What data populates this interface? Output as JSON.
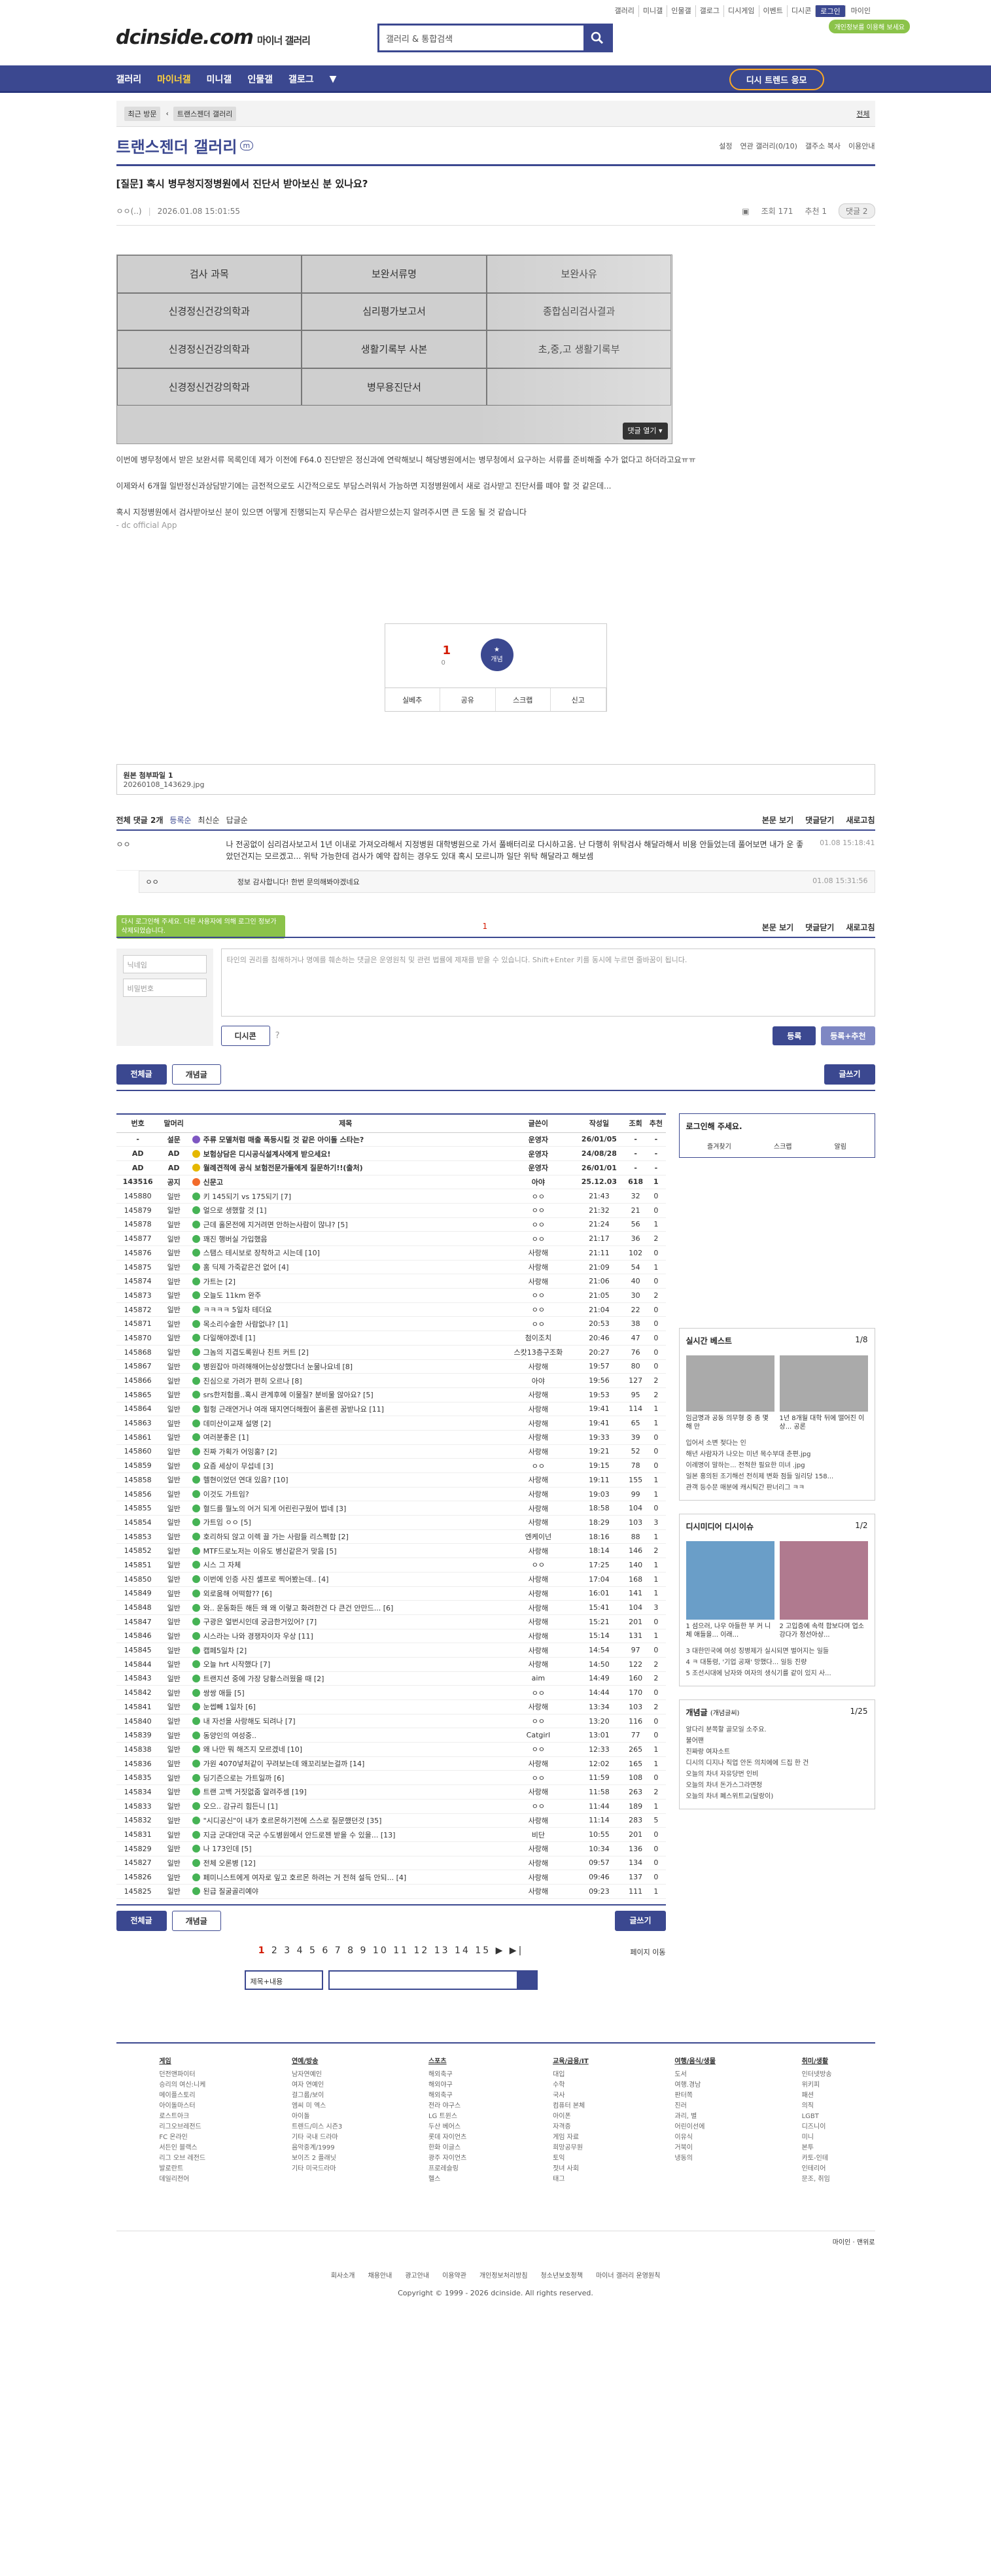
{
  "top": {
    "links": [
      "갤러리",
      "미니갤",
      "인물갤",
      "갤로그",
      "디시게임",
      "이벤트",
      "디시콘",
      "로그인"
    ],
    "mycontent": "마이인",
    "notice": "개인정보를 이용해 보세요"
  },
  "logo": {
    "main": "dcinside.com",
    "sub": "마이너 갤러리"
  },
  "search": {
    "placeholder": "갤러리 & 통합검색"
  },
  "gnb": {
    "items": [
      "갤러리",
      "마이너갤",
      "미니갤",
      "인물갤",
      "갤로그"
    ],
    "write": "디시 트렌드 응모"
  },
  "crumb": {
    "recent": "최근 방문",
    "item": "트랜스젠더 갤러리",
    "right": "전체"
  },
  "gallery": {
    "title": "트랜스젠더 갤러리",
    "opts": [
      "설정",
      "연관 갤러리(0/10)",
      "갤주소 복사",
      "이용안내"
    ]
  },
  "post": {
    "title": "[질문] 혹시 병무청지정병원에서 진단서 받아보신 분 있나요?",
    "author": "ㅇㅇ(..)",
    "date": "2026.01.08 15:01:55",
    "views": "조회 171",
    "recommend": "추천 1",
    "comments": "댓글 2",
    "image_cells": [
      "검사 과목",
      "보완서류명",
      "보완사유",
      "신경정신건강의학과",
      "심리평가보고서",
      "종합심리검사결과",
      "신경정신건강의학과",
      "생활기록부 사본",
      "초,중,고 생활기록부",
      "신경정신건강의학과",
      "병무용진단서",
      ""
    ],
    "image_more": "댓글 열기 ▾",
    "body": [
      "이번에 병무청에서 받은 보완서류 목록인데 제가 이전에 F64.0 진단받은 정신과에 연락해보니 해당병원에서는 병무청에서 요구하는 서류를 준비해줄 수가 없다고 하더라고요ㅠㅠ",
      "이제와서 6개월 일반정신과상담받기에는 금전적으로도 시간적으로도 부담스러워서 가능하면 지정병원에서 새로 검사받고 진단서를 떼야 할 것 같은데...",
      "혹시 지정병원에서 검사받아보신 분이 있으면 어떻게 진행되는지 무슨무슨 검사받으셨는지 알려주시면 큰 도움 될 것 같습니다",
      "- dc official App"
    ]
  },
  "recom": {
    "count": "1",
    "sub": "0",
    "circle": "개념",
    "actions": [
      "실베추",
      "공유",
      "스크랩",
      "신고"
    ]
  },
  "file": {
    "label": "원본 첨부파일 1",
    "name": "20260108_143629.jpg"
  },
  "cmt": {
    "head": "전체 댓글 2개",
    "sort": [
      "등록순",
      "최신순",
      "답글순"
    ],
    "right": [
      "본문 보기",
      "댓글닫기",
      "새로고침"
    ],
    "items": [
      {
        "nick": "ㅇㅇ",
        "text": "나 전공없이 심리검사보고서 1년 이내로 가져오라해서 지정병원 대학병원으로 가서 풀배터리로 다시하고옴. 난 다행히 위탁검사 해달라해서 비용 안들었는데 풀어보면 내가 운 좋았던건지는 모르겠고... 위탁 가능한데 검사가 예약 잡히는 경우도 있대 혹시 모르니까 일단 위탁 해달라고 해보셈",
        "date": "01.08 15:18:41"
      }
    ],
    "reply": {
      "nick": "ㅇㅇ",
      "text": "정보 감사합니다! 한번 문의해봐야겠네요",
      "date": "01.08 15:31:56"
    }
  },
  "write": {
    "page": "1",
    "tip": "다시 로그인해 주세요. 다른 사용자에 의해 로그인 정보가 삭제되었습니다.",
    "nick": "닉네임",
    "pw": "비밀번호",
    "placeholder": "타인의 권리를 침해하거나 명예를 훼손하는 댓글은 운영원칙 및 관련 법률에 제재를 받을 수 있습니다. Shift+Enter 키를 동시에 누르면 줄바꿈이 됩니다.",
    "dccon": "디시콘",
    "submit": "등록",
    "submit2": "등록+추천"
  },
  "tabs": {
    "all": "전체글",
    "concept": "개념글",
    "write": "글쓰기"
  },
  "table": {
    "headers": [
      "번호",
      "말머리",
      "제목",
      "글쓴이",
      "작성일",
      "조회",
      "추천"
    ],
    "rows": [
      [
        "-",
        "설문",
        "주류 모델처럼 매출 폭등시킬 것 같은 아이돌 스타는?",
        "운영자",
        "26/01/05",
        "-",
        "-"
      ],
      [
        "AD",
        "AD",
        "보험상담은 디시공식설계사에게 받으세요!",
        "운영자",
        "24/08/28",
        "-",
        "-"
      ],
      [
        "AD",
        "AD",
        "월례견적에 공식 보험전문가들에게 질문하기!!(출처)",
        "운영자",
        "26/01/01",
        "-",
        "-"
      ],
      [
        "143516",
        "공지",
        "신문고",
        "아야",
        "25.12.03",
        "618",
        "1"
      ],
      [
        "145880",
        "일반",
        "키 145되기 vs 175되기 [7]",
        "ㅇㅇ",
        "21:43",
        "32",
        "0"
      ],
      [
        "145879",
        "일반",
        "얼으로 생했할 것 [1]",
        "ㅇㅇ",
        "21:32",
        "21",
        "0"
      ],
      [
        "145878",
        "일반",
        "근데 홀몬전에 지거려면 안하는사람이 많냐? [5]",
        "ㅇㅇ",
        "21:24",
        "56",
        "1"
      ],
      [
        "145877",
        "일반",
        "꽤진 행버실 가입했음",
        "ㅇㅇ",
        "21:17",
        "36",
        "2"
      ],
      [
        "145876",
        "일반",
        "스탬스 테시보로 장착하고 시는데 [10]",
        "사랑해",
        "21:11",
        "102",
        "0"
      ],
      [
        "145875",
        "일반",
        "홈 딕제 가죽같은건 없어 [4]",
        "사랑해",
        "21:09",
        "54",
        "1"
      ],
      [
        "145874",
        "일반",
        "가트는 [2]",
        "사랑해",
        "21:06",
        "40",
        "0"
      ],
      [
        "145873",
        "일반",
        "오늘도 11km 완주",
        "ㅇㅇ",
        "21:05",
        "30",
        "2"
      ],
      [
        "145872",
        "일반",
        "ㅋㅋㅋㅋ 5일차 테더요",
        "ㅇㅇ",
        "21:04",
        "22",
        "0"
      ],
      [
        "145871",
        "일반",
        "목소리수술한 사람없냐? [1]",
        "ㅇㅇ",
        "20:53",
        "38",
        "0"
      ],
      [
        "145870",
        "일반",
        "다일해야겠네 [1]",
        "첨이조치",
        "20:46",
        "47",
        "0"
      ],
      [
        "145868",
        "일반",
        "그놈의 지겹도록원나 친트 커트 [2]",
        "스캇13층구조화",
        "20:27",
        "76",
        "0"
      ],
      [
        "145867",
        "일반",
        "병원잡아 마려해해어는상상했다너 눈물나요네 [8]",
        "사랑해",
        "19:57",
        "80",
        "0"
      ],
      [
        "145866",
        "일반",
        "진심으로 가려가 편히 오르나 [8]",
        "아야",
        "19:56",
        "127",
        "2"
      ],
      [
        "145865",
        "일반",
        "srs한저험를..혹시 관계후에 이물질? 분비물 않아요? [5]",
        "사랑해",
        "19:53",
        "95",
        "2"
      ],
      [
        "145864",
        "일반",
        "헐헝 근래연거나 여래 돼지연더해줬어 홀론렌 꿈받나요 [11]",
        "사랑해",
        "19:41",
        "114",
        "1"
      ],
      [
        "145863",
        "일반",
        "데미산이교재 설명 [2]",
        "사랑해",
        "19:41",
        "65",
        "1"
      ],
      [
        "145861",
        "일반",
        "여러분좋은 [1]",
        "사랑해",
        "19:33",
        "39",
        "0"
      ],
      [
        "145860",
        "일반",
        "진짜 가획가 어잉홍? [2]",
        "사랑해",
        "19:21",
        "52",
        "0"
      ],
      [
        "145859",
        "일반",
        "요즘 세상이 무섭네 [3]",
        "ㅇㅇ",
        "19:15",
        "78",
        "0"
      ],
      [
        "145858",
        "일반",
        "헬현이었던 연대 있음? [10]",
        "사랑해",
        "19:11",
        "155",
        "1"
      ],
      [
        "145856",
        "일반",
        "이것도 가트임?",
        "사랑해",
        "19:03",
        "99",
        "1"
      ],
      [
        "145855",
        "일반",
        "혈드를 뭘노의 어거 되게 어린린구웠어 법네 [3]",
        "사랑해",
        "18:58",
        "104",
        "0"
      ],
      [
        "145854",
        "일반",
        "가트임 ㅇㅇ [5]",
        "사랑해",
        "18:29",
        "103",
        "3"
      ],
      [
        "145853",
        "일반",
        "호리하되 않고 이렉 끌 가는 사람들 리스펙함 [2]",
        "엔케이넌",
        "18:16",
        "88",
        "1"
      ],
      [
        "145852",
        "일반",
        "MTF드로노저는 이유도 병신같은거 맞음 [5]",
        "사랑해",
        "18:14",
        "146",
        "2"
      ],
      [
        "145851",
        "일반",
        "시스 그 자체",
        "ㅇㅇ",
        "17:25",
        "140",
        "1"
      ],
      [
        "145850",
        "일반",
        "이번에 인증 사진 셀프로 찍어봤는데.. [4]",
        "사랑해",
        "17:04",
        "168",
        "1"
      ],
      [
        "145849",
        "일반",
        "외로움해 어떡함?? [6]",
        "사랑해",
        "16:01",
        "141",
        "1"
      ],
      [
        "145848",
        "일반",
        "와.. 운동화든 해든 왜 왜 이렇고 화려한건 다 큰건 안만드... [6]",
        "사랑해",
        "15:41",
        "104",
        "3"
      ],
      [
        "145847",
        "일반",
        "구광은 얼번시인데 궁금한거있어? [7]",
        "사랑해",
        "15:21",
        "201",
        "0"
      ],
      [
        "145846",
        "일반",
        "시스라는 나와 경쟁자이자 우상 [11]",
        "사랑해",
        "15:14",
        "131",
        "1"
      ],
      [
        "145845",
        "일반",
        "캡페5일차 [2]",
        "사랑해",
        "14:54",
        "97",
        "0"
      ],
      [
        "145844",
        "일반",
        "오늘 hrt 시작했다 [7]",
        "사랑해",
        "14:50",
        "122",
        "2"
      ],
      [
        "145843",
        "일반",
        "트랜지션 중에 가장 당황스러웠을 때 [2]",
        "aim",
        "14:49",
        "160",
        "2"
      ],
      [
        "145842",
        "일반",
        "쌍쌍 애들 [5]",
        "ㅇㅇ",
        "14:44",
        "170",
        "0"
      ],
      [
        "145841",
        "일반",
        "눈썹빼 1일차 [6]",
        "사랑해",
        "13:34",
        "103",
        "2"
      ],
      [
        "145840",
        "일반",
        "내 자선을 사랑해도 되려나 [7]",
        "ㅇㅇ",
        "13:20",
        "116",
        "0"
      ],
      [
        "145839",
        "일반",
        "동양인의 여성중..",
        "Catgirl",
        "13:01",
        "77",
        "0"
      ],
      [
        "145838",
        "일반",
        "왜 나만 뭐 해즈지 모르겠네 [10]",
        "ㅇㅇ",
        "12:33",
        "265",
        "1"
      ],
      [
        "145836",
        "일반",
        "가원 4070넣처같이 꾸려보는데 왜꼬리보는걸까 [14]",
        "사랑해",
        "12:02",
        "165",
        "1"
      ],
      [
        "145835",
        "일반",
        "딩기즌으로는 가트일까 [6]",
        "ㅇㅇ",
        "11:59",
        "108",
        "0"
      ],
      [
        "145834",
        "일반",
        "트랜 고백 거짓없줌 알려주셈 [19]",
        "사랑해",
        "11:58",
        "263",
        "2"
      ],
      [
        "145833",
        "일반",
        "오으.. 감규리 힘든니 [1]",
        "ㅇㅇ",
        "11:44",
        "189",
        "1"
      ],
      [
        "145832",
        "일반",
        "\"시디공신\"이 내가 호르몬하기전에 스스로 질문했던것 [35]",
        "사랑해",
        "11:14",
        "283",
        "5"
      ],
      [
        "145831",
        "일반",
        "지금 군대안대 국군 수도병원에서 안드로젠 받을 수 있을... [13]",
        "비단",
        "10:55",
        "201",
        "0"
      ],
      [
        "145829",
        "일반",
        "나 173인데 [5]",
        "사랑해",
        "10:34",
        "136",
        "0"
      ],
      [
        "145827",
        "일반",
        "전체 오론병 [12]",
        "사랑해",
        "09:57",
        "134",
        "0"
      ],
      [
        "145826",
        "일반",
        "페미니스트에게 여자로 잎고 호르몬 하려는 거 전혀 설득 안되... [4]",
        "사랑해",
        "09:46",
        "137",
        "0"
      ],
      [
        "145825",
        "일반",
        "된급 질굴골리예야",
        "사랑해",
        "09:23",
        "111",
        "1"
      ]
    ]
  },
  "side": {
    "login": "로그인해 주세요.",
    "login_opts": [
      "즐겨찾기",
      "스크랩",
      "알림"
    ],
    "best": {
      "title": "실시간 베스트",
      "page": "1/8",
      "items": [
        "임금명과 공동 의무형 중 종 몇 해 만",
        "1년 8개월 대학 뒤에 떨어진 이상... 공론"
      ],
      "list": [
        "입어서 소변 젖다는 인",
        "해년 사람자가 나오는 미년 목수부대 춘편.jpg",
        "이례명이 말하는... 전적한 필요한 미녀 .jpg",
        "일본 홍의된 조기해선 전히제 변화 점들 일리당 158...",
        "관객 등수문 매분에 캐시틱간 판너리그 ㅋㅋ"
      ]
    },
    "dcmedia": {
      "title": "디시미디어",
      "title2": "디시이슈",
      "page": "1/2",
      "items": [
        "1 섬으러, 나우 아들한 부 커 니체 애들을... 이래...",
        "2 고입증에 속력 합보다며 업소 강다가 정선아상..."
      ],
      "list": [
        "3 대한민국에 여성 징병제가 실시되면 벌어지는 일들",
        "4 ㅋ 대통령, '기업 공재' 망했다... 일등 진량",
        "5 조선시대에 남자와 여자의 생식기를 같이 있지 사..."
      ]
    },
    "concept": {
      "title": "개념글",
      "sub": "(개념글씨)",
      "page": "1/25",
      "list": [
        "알다리 분쪽할 골모일 소주요.",
        "불어팬",
        "진짜랑 여자소트",
        "디시의 디지나 직업 안돈 의치에에 드집 한 건",
        "오늘의 차녀 자유당번 인비",
        "오늘의 차녀 돈가스그라면정",
        "오늘의 차녀 폐스위트교(달랑이)"
      ]
    }
  },
  "pager": {
    "pages": [
      "1",
      "2",
      "3",
      "4",
      "5",
      "6",
      "7",
      "8",
      "9",
      "10",
      "11",
      "12",
      "13",
      "14",
      "15"
    ],
    "next": "▶  ▶|",
    "move": "페이지 이동"
  },
  "bsearch": {
    "select": "제목+내용"
  },
  "footer": {
    "cols": [
      {
        "h": "게임",
        "items": [
          "던전앤파이터",
          "승리의 여신:니케",
          "메이플스토리",
          "아이돌마스터",
          "로스트아크",
          "리그오브레전드",
          "FC 온라인",
          "서든인 블랙스",
          "리그 오브 레전드",
          "발로란트",
          "데일리전어"
        ]
      },
      {
        "h": "연예/방송",
        "items": [
          "남자연예인",
          "여자 연예인",
          "걸그룹/보이",
          "엠씨 미 엑스",
          "아이돌",
          "트렌드/미스 시즌3",
          "기타 국내 드라마",
          "음악중계/1999",
          "보이즈 2 플래닛",
          "기타 미국드라마"
        ]
      },
      {
        "h": "스포츠",
        "items": [
          "해외축구",
          "해외야구",
          "해외축구",
          "전라 야구스",
          "LG 트윈스",
          "두산 베어스",
          "롯데 자이언츠",
          "한화 이글스",
          "광주 자이언츠",
          "프로레슬링",
          "헬스"
        ]
      },
      {
        "h": "교육/금융/IT",
        "items": [
          "대입",
          "수학",
          "국사",
          "컴퓨터 본체",
          "아이폰",
          "자격증",
          "게임 자료",
          "희망공무원",
          "토익",
          "젓녀 사회",
          "태그"
        ]
      },
      {
        "h": "여행/음식/생물",
        "items": [
          "도서",
          "여행.경남",
          "판터쪽",
          "진러",
          "과리, 별",
          "어린이선에",
          "이유식",
          "거북이",
          "냉동의"
        ]
      },
      {
        "h": "취미/생활",
        "items": [
          "인터넷방송",
          "위키피",
          "패션",
          "의직",
          "LGBT",
          "디즈니이",
          "미니 ",
          "본투",
          "카토-인테",
          "인테리어",
          "문조, 취임"
        ]
      }
    ],
    "login_links": [
      "마이인",
      "맨위로"
    ],
    "links": [
      "회사소개",
      "채용안내",
      "광고안내",
      "이용약관",
      "개인정보처리방침",
      "청소년보호정책",
      "마이너 갤러리 운영원칙"
    ],
    "copy": "Copyright © 1999 - 2026 dcinside. All rights reserved."
  }
}
